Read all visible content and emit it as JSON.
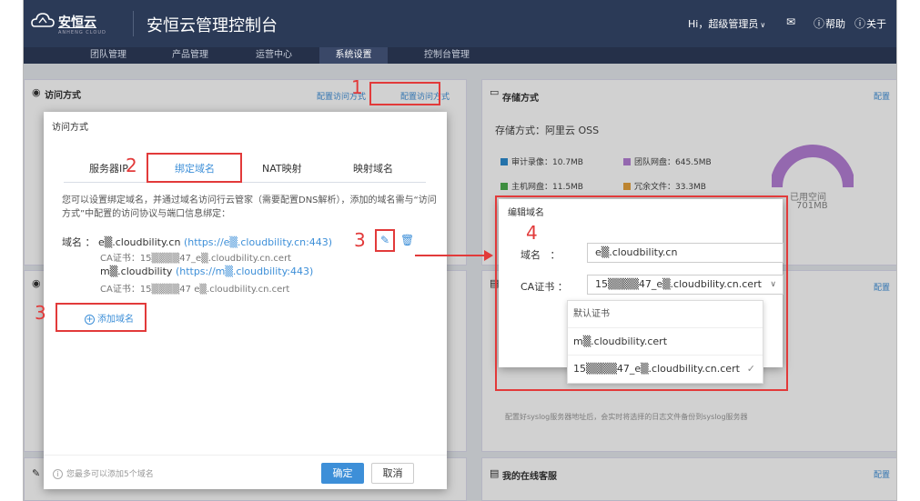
{
  "header": {
    "brand": "安恒云",
    "brand_sub": "ANHENG CLOUD",
    "console_title": "安恒云管理控制台",
    "greeting": "Hi，超级管理员",
    "help": "帮助",
    "about": "关于"
  },
  "nav": {
    "items": [
      {
        "label": "团队管理"
      },
      {
        "label": "产品管理"
      },
      {
        "label": "运营中心"
      },
      {
        "label": "系统设置"
      },
      {
        "label": "控制台管理"
      }
    ],
    "active_index": 3
  },
  "access_card": {
    "title": "访问方式",
    "link": "配置访问方式"
  },
  "storage_card": {
    "title": "存储方式",
    "link": "配置",
    "storage_type": "存储方式：阿里云 OSS",
    "legend": [
      {
        "label": "审计录像：10.7MB",
        "color": "#2d8bd0"
      },
      {
        "label": "团队网盘：645.5MB",
        "color": "#b57fd6"
      },
      {
        "label": "主机网盘：11.5MB",
        "color": "#4cae4f"
      },
      {
        "label": "冗余文件：33.3MB",
        "color": "#e6a23c"
      }
    ],
    "used_label": "已用空间",
    "used_value": "701MB"
  },
  "syslog_card": {
    "link": "配置",
    "desc": "配置好syslog服务器地址后，会实时将选择的日志文件备份到syslog服务器"
  },
  "service_card": {
    "title": "我的在线客服",
    "link": "配置"
  },
  "dialog": {
    "title": "访问方式",
    "tabs": [
      "服务器IP",
      "绑定域名",
      "NAT映射",
      "映射域名"
    ],
    "active_tab": 1,
    "description": "您可以设置绑定域名，并通过域名访问行云管家（需要配置DNS解析），添加的域名需与“访问方式”中配置的访问协议与端口信息绑定：",
    "domain_label": "域名",
    "domains": [
      {
        "name": "e▒.cloudbility.cn",
        "url": "(https://e▒.cloudbility.cn:443)",
        "cert": "CA证书：15▒▒▒▒47_e▒.cloudbility.cn.cert"
      },
      {
        "name": "m▒.cloudbility",
        "url": "(https://m▒.cloudbility:443)",
        "cert": "CA证书：15▒▒▒▒47 e▒.cloudbility.cn.cert"
      }
    ],
    "add_domain": "添加域名",
    "tip": "您最多可以添加5个域名",
    "ok": "确定",
    "cancel": "取消"
  },
  "edit_popup": {
    "title": "编辑域名",
    "domain_label": "域名",
    "domain_value": "e▒.cloudbility.cn",
    "cert_label": "CA证书",
    "cert_value": "15▒▒▒▒47_e▒.cloudbility.cn.cert",
    "options": [
      {
        "label": "默认证书",
        "selected": false
      },
      {
        "label": "m▒.cloudbility.cert",
        "selected": false
      },
      {
        "label": "15▒▒▒▒47_e▒.cloudbility.cn.cert",
        "selected": true
      }
    ]
  },
  "annotations": [
    "1",
    "2",
    "3",
    "3",
    "4"
  ],
  "colors": {
    "accent": "#3d8fd8",
    "annotation": "#e23a3a",
    "topbar": "#2b3a57"
  }
}
